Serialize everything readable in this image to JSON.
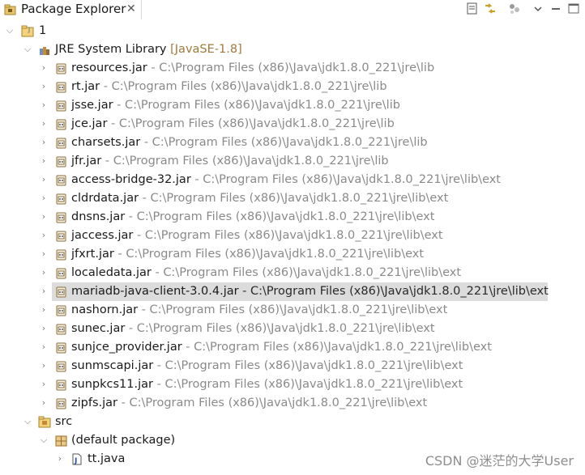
{
  "view": {
    "title": "Package Explorer",
    "close_symbol": "✕",
    "toolbar_icons": [
      "collapse-all-icon",
      "link-with-editor-icon",
      "focus-tasks-icon",
      "view-menu-icon",
      "minimize-icon",
      "maximize-icon"
    ]
  },
  "tree": {
    "project": {
      "name": "1"
    },
    "jre": {
      "name": "JRE System Library",
      "decoration": "[JavaSE-1.8]"
    },
    "jars": [
      {
        "name": "resources.jar",
        "path": "C:\\Program Files (x86)\\Java\\jdk1.8.0_221\\jre\\lib"
      },
      {
        "name": "rt.jar",
        "path": "C:\\Program Files (x86)\\Java\\jdk1.8.0_221\\jre\\lib"
      },
      {
        "name": "jsse.jar",
        "path": "C:\\Program Files (x86)\\Java\\jdk1.8.0_221\\jre\\lib"
      },
      {
        "name": "jce.jar",
        "path": "C:\\Program Files (x86)\\Java\\jdk1.8.0_221\\jre\\lib"
      },
      {
        "name": "charsets.jar",
        "path": "C:\\Program Files (x86)\\Java\\jdk1.8.0_221\\jre\\lib"
      },
      {
        "name": "jfr.jar",
        "path": "C:\\Program Files (x86)\\Java\\jdk1.8.0_221\\jre\\lib"
      },
      {
        "name": "access-bridge-32.jar",
        "path": "C:\\Program Files (x86)\\Java\\jdk1.8.0_221\\jre\\lib\\ext"
      },
      {
        "name": "cldrdata.jar",
        "path": "C:\\Program Files (x86)\\Java\\jdk1.8.0_221\\jre\\lib\\ext"
      },
      {
        "name": "dnsns.jar",
        "path": "C:\\Program Files (x86)\\Java\\jdk1.8.0_221\\jre\\lib\\ext"
      },
      {
        "name": "jaccess.jar",
        "path": "C:\\Program Files (x86)\\Java\\jdk1.8.0_221\\jre\\lib\\ext"
      },
      {
        "name": "jfxrt.jar",
        "path": "C:\\Program Files (x86)\\Java\\jdk1.8.0_221\\jre\\lib\\ext"
      },
      {
        "name": "localedata.jar",
        "path": "C:\\Program Files (x86)\\Java\\jdk1.8.0_221\\jre\\lib\\ext"
      },
      {
        "name": "mariadb-java-client-3.0.4.jar",
        "path": "C:\\Program Files (x86)\\Java\\jdk1.8.0_221\\jre\\lib\\ext",
        "selected": true
      },
      {
        "name": "nashorn.jar",
        "path": "C:\\Program Files (x86)\\Java\\jdk1.8.0_221\\jre\\lib\\ext"
      },
      {
        "name": "sunec.jar",
        "path": "C:\\Program Files (x86)\\Java\\jdk1.8.0_221\\jre\\lib\\ext"
      },
      {
        "name": "sunjce_provider.jar",
        "path": "C:\\Program Files (x86)\\Java\\jdk1.8.0_221\\jre\\lib\\ext"
      },
      {
        "name": "sunmscapi.jar",
        "path": "C:\\Program Files (x86)\\Java\\jdk1.8.0_221\\jre\\lib\\ext"
      },
      {
        "name": "sunpkcs11.jar",
        "path": "C:\\Program Files (x86)\\Java\\jdk1.8.0_221\\jre\\lib\\ext"
      },
      {
        "name": "zipfs.jar",
        "path": "C:\\Program Files (x86)\\Java\\jdk1.8.0_221\\jre\\lib\\ext"
      }
    ],
    "jar_separator": " - ",
    "src": {
      "name": "src"
    },
    "package": {
      "name": "(default package)"
    },
    "file": {
      "name": "tt.java"
    }
  },
  "watermark": "CSDN @迷茫的大学User",
  "colors": {
    "selection": "#dcdcdc",
    "decoration": "#8a8a8a",
    "library_decoration": "#a07b3c",
    "jar_icon": "#8a6d3b"
  }
}
